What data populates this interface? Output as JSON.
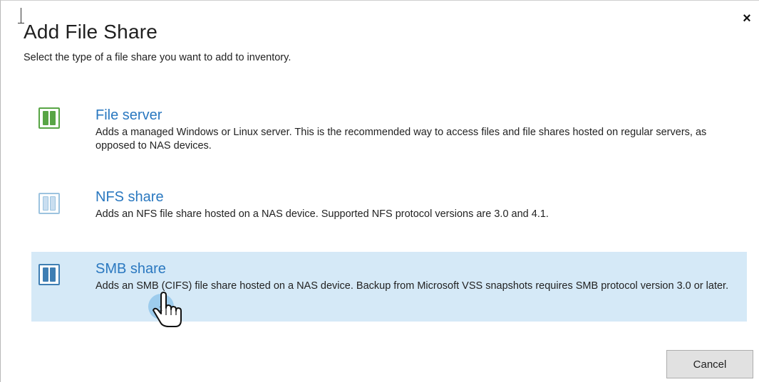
{
  "dialog": {
    "title": "Add File Share",
    "subtitle": "Select the type of a file share you want to add to inventory.",
    "close_label": "×",
    "cancel_label": "Cancel"
  },
  "options": [
    {
      "title": "File server",
      "description": "Adds a managed Windows or Linux server. This is the recommended way to access files and file shares hosted on regular servers, as opposed to NAS devices.",
      "icon": "file-server-icon",
      "selected": false
    },
    {
      "title": "NFS share",
      "description": "Adds an NFS file share hosted on a NAS device. Supported NFS protocol versions are 3.0 and 4.1.",
      "icon": "nfs-share-icon",
      "selected": false
    },
    {
      "title": "SMB share",
      "description": "Adds an SMB (CIFS) file share hosted on a NAS device. Backup from Microsoft VSS snapshots requires SMB protocol version 3.0 or later.",
      "icon": "smb-share-icon",
      "selected": true
    }
  ],
  "cursor": {
    "click_count": "1"
  },
  "colors": {
    "accent": "#2a78c0",
    "selection": "#d5e9f7",
    "file_server_icon": "#58a545",
    "nfs_icon": "#9cc3df",
    "smb_icon": "#3e7eb3"
  }
}
